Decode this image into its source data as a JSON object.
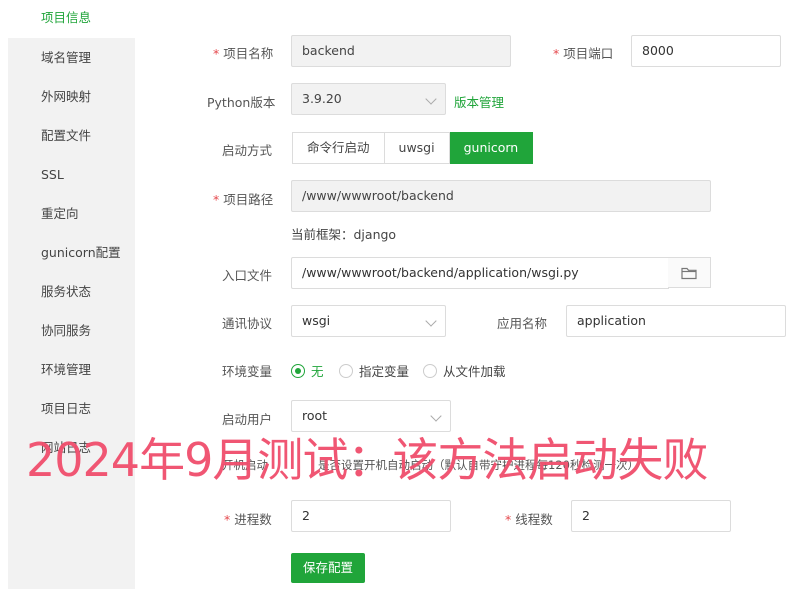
{
  "sidebar": {
    "items": [
      {
        "label": "项目信息"
      },
      {
        "label": "域名管理"
      },
      {
        "label": "外网映射"
      },
      {
        "label": "配置文件"
      },
      {
        "label": "SSL"
      },
      {
        "label": "重定向"
      },
      {
        "label": "gunicorn配置"
      },
      {
        "label": "服务状态"
      },
      {
        "label": "协同服务"
      },
      {
        "label": "环境管理"
      },
      {
        "label": "项目日志"
      },
      {
        "label": "网站日志"
      }
    ]
  },
  "form": {
    "project_name": {
      "label": "项目名称",
      "value": "backend"
    },
    "project_port": {
      "label": "项目端口",
      "value": "8000"
    },
    "python_version": {
      "label": "Python版本",
      "value": "3.9.20",
      "link": "版本管理"
    },
    "start_mode": {
      "label": "启动方式",
      "options": [
        "命令行启动",
        "uwsgi",
        "gunicorn"
      ],
      "selected": "gunicorn"
    },
    "project_path": {
      "label": "项目路径",
      "value": "/www/wwwroot/backend",
      "framework_note": "当前框架：django"
    },
    "entry_file": {
      "label": "入口文件",
      "value": "/www/wwwroot/backend/application/wsgi.py"
    },
    "protocol": {
      "label": "通讯协议",
      "value": "wsgi"
    },
    "app_name": {
      "label": "应用名称",
      "value": "application"
    },
    "env_vars": {
      "label": "环境变量",
      "options": [
        "无",
        "指定变量",
        "从文件加载"
      ],
      "selected": "无"
    },
    "start_user": {
      "label": "启动用户",
      "value": "root"
    },
    "autostart": {
      "label": "开机启动",
      "text": "是否设置开机自动启动（默认自带守护进程每120秒检测一次）"
    },
    "processes": {
      "label": "进程数",
      "value": "2"
    },
    "threads": {
      "label": "线程数",
      "value": "2"
    },
    "save_label": "保存配置"
  },
  "overlay_text": "2024年9月测试：该方法启动失败",
  "colors": {
    "accent": "#20a53a",
    "required": "#e5484d",
    "overlay": "#f0506e"
  }
}
